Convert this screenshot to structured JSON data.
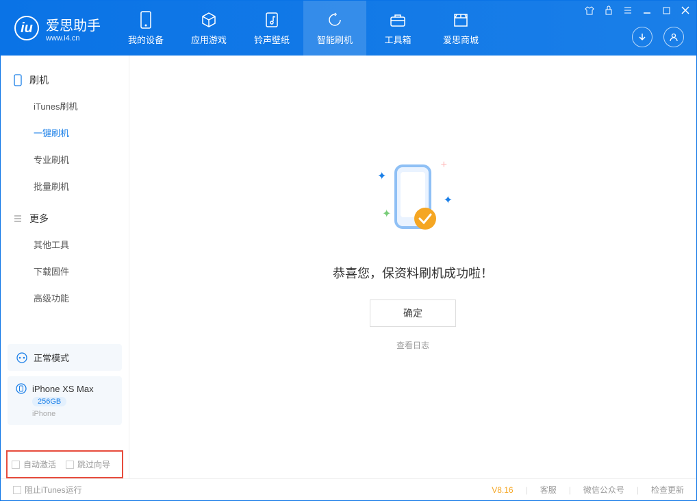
{
  "app": {
    "name": "爱思助手",
    "subtext": "www.i4.cn"
  },
  "nav": {
    "tabs": [
      {
        "label": "我的设备",
        "icon": "device-icon"
      },
      {
        "label": "应用游戏",
        "icon": "cube-icon"
      },
      {
        "label": "铃声壁纸",
        "icon": "music-icon"
      },
      {
        "label": "智能刷机",
        "icon": "refresh-icon",
        "active": true
      },
      {
        "label": "工具箱",
        "icon": "toolbox-icon"
      },
      {
        "label": "爱思商城",
        "icon": "store-icon"
      }
    ]
  },
  "sidebar": {
    "sections": [
      {
        "title": "刷机",
        "icon": "flash-icon",
        "items": [
          {
            "label": "iTunes刷机"
          },
          {
            "label": "一键刷机",
            "active": true
          },
          {
            "label": "专业刷机"
          },
          {
            "label": "批量刷机"
          }
        ]
      },
      {
        "title": "更多",
        "icon": "more-icon",
        "items": [
          {
            "label": "其他工具"
          },
          {
            "label": "下载固件"
          },
          {
            "label": "高级功能"
          }
        ]
      }
    ],
    "mode_card": {
      "label": "正常模式"
    },
    "device_card": {
      "name": "iPhone XS Max",
      "storage": "256GB",
      "type": "iPhone"
    },
    "bottom": {
      "auto_activate": "自动激活",
      "skip_guide": "跳过向导"
    }
  },
  "main": {
    "success_message": "恭喜您，保资料刷机成功啦！",
    "ok_button": "确定",
    "view_log": "查看日志"
  },
  "footer": {
    "stop_itunes": "阻止iTunes运行",
    "version": "V8.16",
    "service": "客服",
    "wechat": "微信公众号",
    "check_update": "检查更新"
  }
}
